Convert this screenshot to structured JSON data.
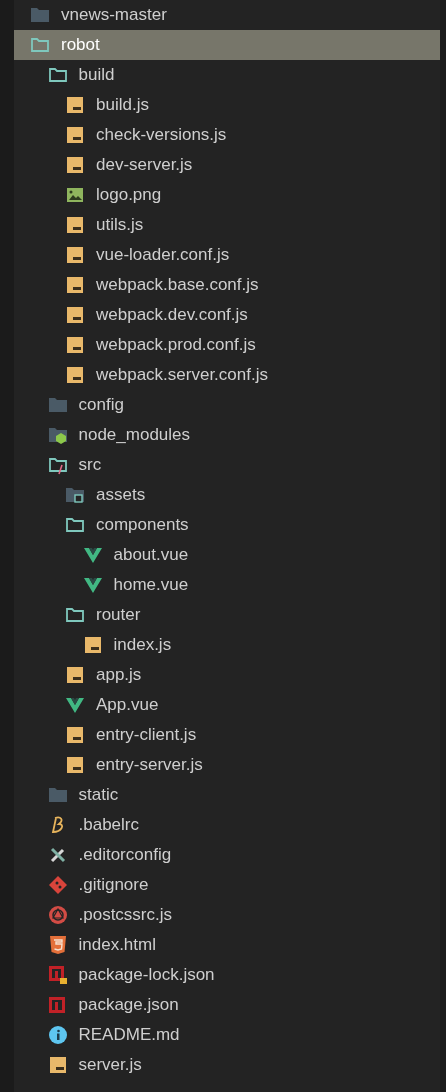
{
  "tree": [
    {
      "name": "vnews-master",
      "kind": "folder",
      "selected": false
    },
    {
      "name": "robot",
      "kind": "folder-open",
      "selected": true,
      "children": [
        {
          "name": "build",
          "kind": "folder-open",
          "selected": false,
          "children": [
            {
              "name": "build.js",
              "kind": "js",
              "selected": false
            },
            {
              "name": "check-versions.js",
              "kind": "js",
              "selected": false
            },
            {
              "name": "dev-server.js",
              "kind": "js",
              "selected": false
            },
            {
              "name": "logo.png",
              "kind": "image",
              "selected": false
            },
            {
              "name": "utils.js",
              "kind": "js",
              "selected": false
            },
            {
              "name": "vue-loader.conf.js",
              "kind": "js",
              "selected": false
            },
            {
              "name": "webpack.base.conf.js",
              "kind": "js",
              "selected": false
            },
            {
              "name": "webpack.dev.conf.js",
              "kind": "js",
              "selected": false
            },
            {
              "name": "webpack.prod.conf.js",
              "kind": "js",
              "selected": false
            },
            {
              "name": "webpack.server.conf.js",
              "kind": "js",
              "selected": false
            }
          ]
        },
        {
          "name": "config",
          "kind": "folder",
          "selected": false
        },
        {
          "name": "node_modules",
          "kind": "folder-node",
          "selected": false
        },
        {
          "name": "src",
          "kind": "folder-src",
          "selected": false,
          "children": [
            {
              "name": "assets",
              "kind": "folder-assets",
              "selected": false
            },
            {
              "name": "components",
              "kind": "folder-open",
              "selected": false,
              "children": [
                {
                  "name": "about.vue",
                  "kind": "vue",
                  "selected": false
                },
                {
                  "name": "home.vue",
                  "kind": "vue",
                  "selected": false
                }
              ]
            },
            {
              "name": "router",
              "kind": "folder-open",
              "selected": false,
              "children": [
                {
                  "name": "index.js",
                  "kind": "js",
                  "selected": false
                }
              ]
            },
            {
              "name": "app.js",
              "kind": "js",
              "selected": false
            },
            {
              "name": "App.vue",
              "kind": "vue",
              "selected": false
            },
            {
              "name": "entry-client.js",
              "kind": "js",
              "selected": false
            },
            {
              "name": "entry-server.js",
              "kind": "js",
              "selected": false
            }
          ]
        },
        {
          "name": "static",
          "kind": "folder",
          "selected": false
        },
        {
          "name": ".babelrc",
          "kind": "babel",
          "selected": false
        },
        {
          "name": ".editorconfig",
          "kind": "tools",
          "selected": false
        },
        {
          "name": ".gitignore",
          "kind": "git",
          "selected": false
        },
        {
          "name": ".postcssrc.js",
          "kind": "postcss",
          "selected": false
        },
        {
          "name": "index.html",
          "kind": "html",
          "selected": false
        },
        {
          "name": "package-lock.json",
          "kind": "npm-lock",
          "selected": false
        },
        {
          "name": "package.json",
          "kind": "npm",
          "selected": false
        },
        {
          "name": "README.md",
          "kind": "info",
          "selected": false
        },
        {
          "name": "server.js",
          "kind": "js",
          "selected": false
        }
      ]
    }
  ]
}
